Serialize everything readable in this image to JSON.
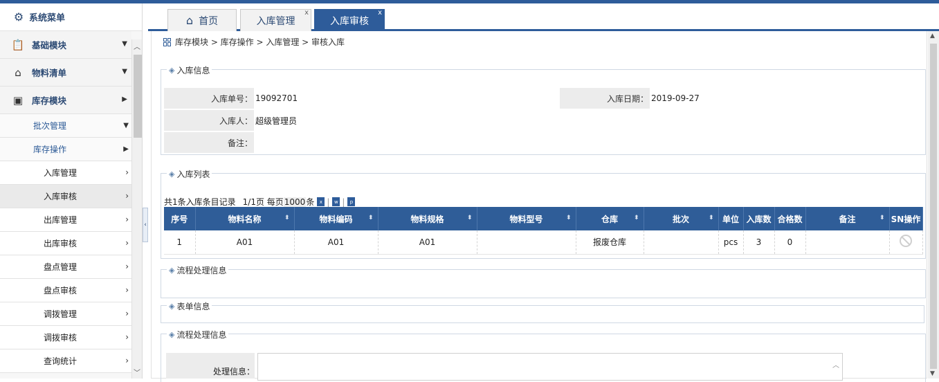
{
  "sidebar": {
    "title": "系统菜单",
    "menus": [
      {
        "label": "基础模块",
        "icon": "clipboard-icon",
        "arrow": "▼"
      },
      {
        "label": "物料清单",
        "icon": "home-icon",
        "arrow": "▼"
      },
      {
        "label": "库存模块",
        "icon": "box-icon",
        "arrow": "▶"
      }
    ],
    "subs": [
      {
        "label": "批次管理",
        "arrow": "▼"
      },
      {
        "label": "库存操作",
        "arrow": "▶"
      }
    ],
    "items": [
      {
        "label": "入库管理"
      },
      {
        "label": "入库审核"
      },
      {
        "label": "出库管理"
      },
      {
        "label": "出库审核"
      },
      {
        "label": "盘点管理"
      },
      {
        "label": "盘点审核"
      },
      {
        "label": "调拨管理"
      },
      {
        "label": "调拨审核"
      },
      {
        "label": "查询统计"
      }
    ]
  },
  "tabs": [
    {
      "label": "首页"
    },
    {
      "label": "入库管理",
      "close": "x"
    },
    {
      "label": "入库审核",
      "close": "x"
    }
  ],
  "breadcrumb": "库存模块 > 库存操作 > 入库管理 > 审核入库",
  "info": {
    "legend": "入库信息",
    "no_label": "入库单号：",
    "no_value": "19092701",
    "date_label": "入库日期：",
    "date_value": "2019-09-27",
    "user_label": "入库人：",
    "user_value": "超级管理员",
    "remark_label": "备注："
  },
  "list": {
    "legend": "入库列表",
    "summary_a": "共1条入库条目记录",
    "summary_b": "1/1页 每页",
    "page_size": "1000",
    "summary_c": "条",
    "headers": [
      "序号",
      "物料名称",
      "物料编码",
      "物料规格",
      "物料型号",
      "仓库",
      "批次",
      "单位",
      "入库数",
      "合格数",
      "备注",
      "SN操作"
    ],
    "rows": [
      [
        "1",
        "A01",
        "A01",
        "A01",
        "",
        "报废仓库",
        "",
        "pcs",
        "3",
        "0",
        ""
      ]
    ]
  },
  "flow_legend": "流程处理信息",
  "form_legend": "表单信息",
  "flow2_legend": "流程处理信息",
  "process_label": "处理信息："
}
